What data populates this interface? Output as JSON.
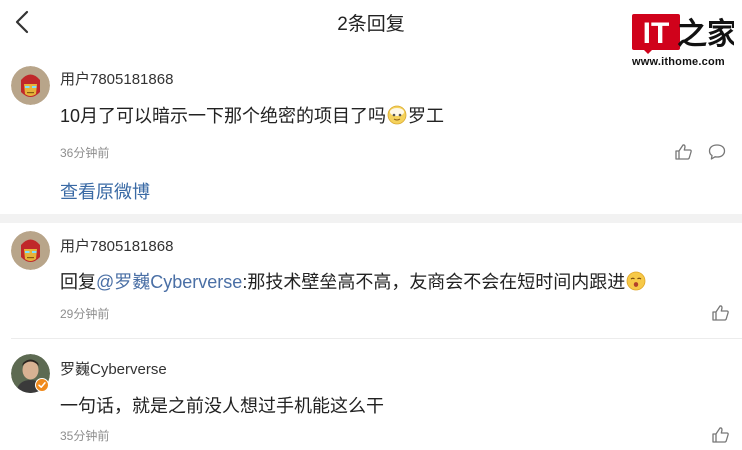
{
  "header": {
    "title": "2条回复"
  },
  "logo": {
    "mark": "IT之家",
    "url": "www.ithome.com"
  },
  "comments": [
    {
      "user": "用户7805181868",
      "text_before": "10月了可以暗示一下那个绝密的项目了吗",
      "text_after": "罗工",
      "time": "36分钟前",
      "view_original": "查看原微博"
    },
    {
      "user": "用户7805181868",
      "reply_prefix": "回复",
      "mention": "@罗巍Cyberverse",
      "text": ":那技术壁垒高不高，友商会不会在短时间内跟进",
      "time": "29分钟前"
    },
    {
      "user": "罗巍Cyberverse",
      "text": "一句话，就是之前没人想过手机能这么干",
      "time": "35分钟前"
    }
  ],
  "icons": {
    "back": "chevron-left-icon",
    "like": "thumbs-up-icon",
    "comment": "comment-bubble-icon",
    "verified": "verified-badge-icon"
  },
  "colors": {
    "link": "#3a6aa5",
    "mention": "#4a6fa5",
    "muted": "#8e8e8e",
    "verified": "#f08a1c",
    "logo_red": "#d0021b"
  }
}
